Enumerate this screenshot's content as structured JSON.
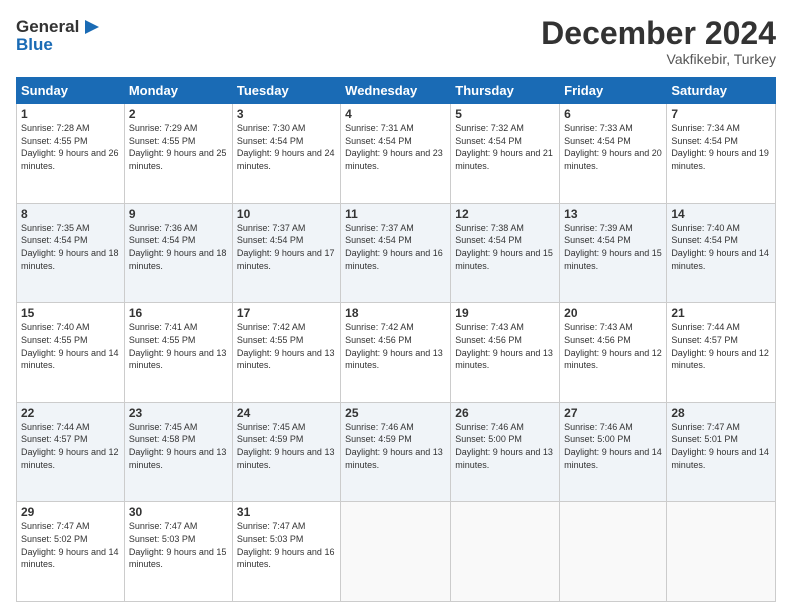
{
  "logo": {
    "line1": "General",
    "line2": "Blue"
  },
  "title": "December 2024",
  "location": "Vakfikebir, Turkey",
  "days_header": [
    "Sunday",
    "Monday",
    "Tuesday",
    "Wednesday",
    "Thursday",
    "Friday",
    "Saturday"
  ],
  "weeks": [
    [
      {
        "day": "1",
        "sunrise": "Sunrise: 7:28 AM",
        "sunset": "Sunset: 4:55 PM",
        "daylight": "Daylight: 9 hours and 26 minutes."
      },
      {
        "day": "2",
        "sunrise": "Sunrise: 7:29 AM",
        "sunset": "Sunset: 4:55 PM",
        "daylight": "Daylight: 9 hours and 25 minutes."
      },
      {
        "day": "3",
        "sunrise": "Sunrise: 7:30 AM",
        "sunset": "Sunset: 4:54 PM",
        "daylight": "Daylight: 9 hours and 24 minutes."
      },
      {
        "day": "4",
        "sunrise": "Sunrise: 7:31 AM",
        "sunset": "Sunset: 4:54 PM",
        "daylight": "Daylight: 9 hours and 23 minutes."
      },
      {
        "day": "5",
        "sunrise": "Sunrise: 7:32 AM",
        "sunset": "Sunset: 4:54 PM",
        "daylight": "Daylight: 9 hours and 21 minutes."
      },
      {
        "day": "6",
        "sunrise": "Sunrise: 7:33 AM",
        "sunset": "Sunset: 4:54 PM",
        "daylight": "Daylight: 9 hours and 20 minutes."
      },
      {
        "day": "7",
        "sunrise": "Sunrise: 7:34 AM",
        "sunset": "Sunset: 4:54 PM",
        "daylight": "Daylight: 9 hours and 19 minutes."
      }
    ],
    [
      {
        "day": "8",
        "sunrise": "Sunrise: 7:35 AM",
        "sunset": "Sunset: 4:54 PM",
        "daylight": "Daylight: 9 hours and 18 minutes."
      },
      {
        "day": "9",
        "sunrise": "Sunrise: 7:36 AM",
        "sunset": "Sunset: 4:54 PM",
        "daylight": "Daylight: 9 hours and 18 minutes."
      },
      {
        "day": "10",
        "sunrise": "Sunrise: 7:37 AM",
        "sunset": "Sunset: 4:54 PM",
        "daylight": "Daylight: 9 hours and 17 minutes."
      },
      {
        "day": "11",
        "sunrise": "Sunrise: 7:37 AM",
        "sunset": "Sunset: 4:54 PM",
        "daylight": "Daylight: 9 hours and 16 minutes."
      },
      {
        "day": "12",
        "sunrise": "Sunrise: 7:38 AM",
        "sunset": "Sunset: 4:54 PM",
        "daylight": "Daylight: 9 hours and 15 minutes."
      },
      {
        "day": "13",
        "sunrise": "Sunrise: 7:39 AM",
        "sunset": "Sunset: 4:54 PM",
        "daylight": "Daylight: 9 hours and 15 minutes."
      },
      {
        "day": "14",
        "sunrise": "Sunrise: 7:40 AM",
        "sunset": "Sunset: 4:54 PM",
        "daylight": "Daylight: 9 hours and 14 minutes."
      }
    ],
    [
      {
        "day": "15",
        "sunrise": "Sunrise: 7:40 AM",
        "sunset": "Sunset: 4:55 PM",
        "daylight": "Daylight: 9 hours and 14 minutes."
      },
      {
        "day": "16",
        "sunrise": "Sunrise: 7:41 AM",
        "sunset": "Sunset: 4:55 PM",
        "daylight": "Daylight: 9 hours and 13 minutes."
      },
      {
        "day": "17",
        "sunrise": "Sunrise: 7:42 AM",
        "sunset": "Sunset: 4:55 PM",
        "daylight": "Daylight: 9 hours and 13 minutes."
      },
      {
        "day": "18",
        "sunrise": "Sunrise: 7:42 AM",
        "sunset": "Sunset: 4:56 PM",
        "daylight": "Daylight: 9 hours and 13 minutes."
      },
      {
        "day": "19",
        "sunrise": "Sunrise: 7:43 AM",
        "sunset": "Sunset: 4:56 PM",
        "daylight": "Daylight: 9 hours and 13 minutes."
      },
      {
        "day": "20",
        "sunrise": "Sunrise: 7:43 AM",
        "sunset": "Sunset: 4:56 PM",
        "daylight": "Daylight: 9 hours and 12 minutes."
      },
      {
        "day": "21",
        "sunrise": "Sunrise: 7:44 AM",
        "sunset": "Sunset: 4:57 PM",
        "daylight": "Daylight: 9 hours and 12 minutes."
      }
    ],
    [
      {
        "day": "22",
        "sunrise": "Sunrise: 7:44 AM",
        "sunset": "Sunset: 4:57 PM",
        "daylight": "Daylight: 9 hours and 12 minutes."
      },
      {
        "day": "23",
        "sunrise": "Sunrise: 7:45 AM",
        "sunset": "Sunset: 4:58 PM",
        "daylight": "Daylight: 9 hours and 13 minutes."
      },
      {
        "day": "24",
        "sunrise": "Sunrise: 7:45 AM",
        "sunset": "Sunset: 4:59 PM",
        "daylight": "Daylight: 9 hours and 13 minutes."
      },
      {
        "day": "25",
        "sunrise": "Sunrise: 7:46 AM",
        "sunset": "Sunset: 4:59 PM",
        "daylight": "Daylight: 9 hours and 13 minutes."
      },
      {
        "day": "26",
        "sunrise": "Sunrise: 7:46 AM",
        "sunset": "Sunset: 5:00 PM",
        "daylight": "Daylight: 9 hours and 13 minutes."
      },
      {
        "day": "27",
        "sunrise": "Sunrise: 7:46 AM",
        "sunset": "Sunset: 5:00 PM",
        "daylight": "Daylight: 9 hours and 14 minutes."
      },
      {
        "day": "28",
        "sunrise": "Sunrise: 7:47 AM",
        "sunset": "Sunset: 5:01 PM",
        "daylight": "Daylight: 9 hours and 14 minutes."
      }
    ],
    [
      {
        "day": "29",
        "sunrise": "Sunrise: 7:47 AM",
        "sunset": "Sunset: 5:02 PM",
        "daylight": "Daylight: 9 hours and 14 minutes."
      },
      {
        "day": "30",
        "sunrise": "Sunrise: 7:47 AM",
        "sunset": "Sunset: 5:03 PM",
        "daylight": "Daylight: 9 hours and 15 minutes."
      },
      {
        "day": "31",
        "sunrise": "Sunrise: 7:47 AM",
        "sunset": "Sunset: 5:03 PM",
        "daylight": "Daylight: 9 hours and 16 minutes."
      },
      null,
      null,
      null,
      null
    ]
  ]
}
